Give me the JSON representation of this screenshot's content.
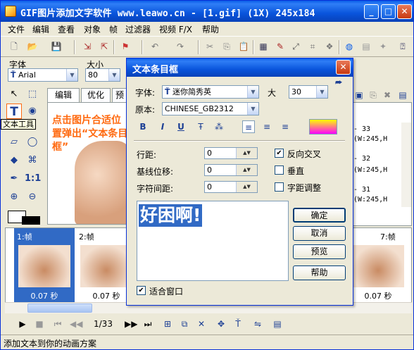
{
  "window": {
    "title": "GIF图片添加文字软件 www.leawo.cn - [1.gif] (1X) 245x184",
    "min": "_",
    "max": "□",
    "close": "✕"
  },
  "menu": [
    "文件",
    "编辑",
    "查看",
    "对象",
    "帧",
    "过滤器",
    "视频 F/X",
    "帮助"
  ],
  "fontbar": {
    "font_label": "字体",
    "font_value": "Arial",
    "size_label": "大小",
    "size_value": "80"
  },
  "tooltip": "文本工具",
  "tabs": [
    "编辑",
    "优化",
    "预"
  ],
  "instruction": "点击图片合适位置弹出“文本条目框”",
  "framelist": [
    {
      "id": "- 33",
      "info": "(W:245,H"
    },
    {
      "id": "- 32",
      "info": "(W:245,H"
    },
    {
      "id": "- 31",
      "info": "(W:245,H"
    }
  ],
  "frames": [
    {
      "label": "1:帧",
      "delay": "0.07 秒"
    },
    {
      "label": "2:帧",
      "delay": "0.07 秒"
    },
    {
      "label": "7:帧",
      "delay": "0.07 秒"
    }
  ],
  "player": {
    "position": "1/33"
  },
  "status": "添加文本到你的动画方案",
  "dialog": {
    "title": "文本条目框",
    "font_label": "字体:",
    "font_value": "迷你简秀英",
    "size_label": "大",
    "size_value": "30",
    "source_label": "原本:",
    "source_value": "CHINESE_GB2312",
    "bold": "B",
    "italic": "I",
    "underline": "U",
    "line_spacing_label": "行距:",
    "line_spacing_value": "0",
    "baseline_label": "基线位移:",
    "baseline_value": "0",
    "char_spacing_label": "字符间距:",
    "char_spacing_value": "0",
    "antialias_label": "反向交叉",
    "antialias_checked": true,
    "vertical_label": "垂直",
    "vertical_checked": false,
    "kerning_label": "字距调整",
    "kerning_checked": false,
    "sample_text": "好困啊!",
    "fit_window_label": "适合窗口",
    "fit_window_checked": true,
    "ok": "确定",
    "cancel": "取消",
    "preview": "预览",
    "help": "帮助",
    "color_gradient": [
      "#ffff00",
      "#ff00ff"
    ]
  }
}
